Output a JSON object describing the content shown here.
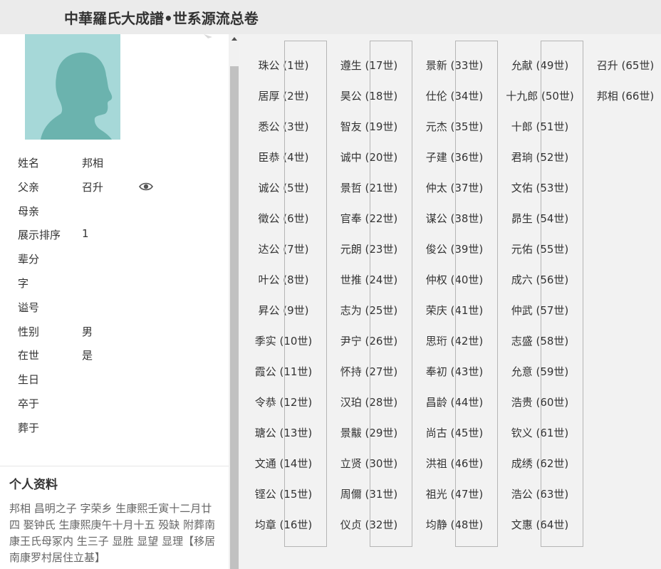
{
  "header": {
    "title": "中華羅氏大成譜•世系源流总卷"
  },
  "person": {
    "fields": [
      {
        "label": "姓名",
        "value": "邦相"
      },
      {
        "label": "父亲",
        "value": "召升"
      },
      {
        "label": "母亲",
        "value": ""
      },
      {
        "label": "展示排序",
        "value": "1"
      },
      {
        "label": "辈分",
        "value": ""
      },
      {
        "label": "字",
        "value": ""
      },
      {
        "label": "谥号",
        "value": ""
      },
      {
        "label": "性别",
        "value": "男"
      },
      {
        "label": "在世",
        "value": "是"
      },
      {
        "label": "生日",
        "value": ""
      },
      {
        "label": "卒于",
        "value": ""
      },
      {
        "label": "葬于",
        "value": ""
      }
    ],
    "icons": {
      "avatar": "person-silhouette-icon",
      "father_view": "eye-icon",
      "edit": "pencil-icon"
    }
  },
  "profile": {
    "title": "个人资料",
    "text": "邦相 昌明之子 字荣乡 生康熙壬寅十二月廿四 娶钟氏 生康熙庚午十月十五 殁缺 附葬南康王氏母冢内 生三子 显胜 显望 显理【移居南康罗村居住立基】"
  },
  "lineage": {
    "columns": [
      [
        "珠公 (1世)",
        "居厚 (2世)",
        "悉公 (3世)",
        "臣恭 (4世)",
        "诚公 (5世)",
        "徵公 (6世)",
        "达公 (7世)",
        "叶公 (8世)",
        "昇公 (9世)",
        "季实 (10世)",
        "霞公 (11世)",
        "令恭 (12世)",
        "瑭公 (13世)",
        "文通 (14世)",
        "铿公 (15世)",
        "均章 (16世)"
      ],
      [
        "遵生 (17世)",
        "昊公 (18世)",
        "智友 (19世)",
        "诚中 (20世)",
        "景哲 (21世)",
        "官奉 (22世)",
        "元朗 (23世)",
        "世推 (24世)",
        "志为 (25世)",
        "尹宁 (26世)",
        "怀持 (27世)",
        "汉珀 (28世)",
        "景黻 (29世)",
        "立贤 (30世)",
        "周儞 (31世)",
        "仪贞 (32世)"
      ],
      [
        "景新 (33世)",
        "仕伦 (34世)",
        "元杰 (35世)",
        "子建 (36世)",
        "仲太 (37世)",
        "谋公 (38世)",
        "俊公 (39世)",
        "仲权 (40世)",
        "荣庆 (41世)",
        "思珩 (42世)",
        "奉初 (43世)",
        "昌龄 (44世)",
        "尚古 (45世)",
        "洪祖 (46世)",
        "祖光 (47世)",
        "均静 (48世)"
      ],
      [
        "允献 (49世)",
        "十九郎 (50世)",
        "十郎 (51世)",
        "君珦 (52世)",
        "文佑 (53世)",
        "昴生 (54世)",
        "元佑 (55世)",
        "成六 (56世)",
        "仲武 (57世)",
        "志盛 (58世)",
        "允意 (59世)",
        "浩贵 (60世)",
        "钦义 (61世)",
        "成绣 (62世)",
        "浩公 (63世)",
        "文惠 (64世)"
      ],
      [
        "召升 (65世)",
        "邦相 (66世)"
      ]
    ]
  },
  "colors": {
    "header_bg": "#ebebeb",
    "avatar_bg": "#a6d8d8",
    "avatar_silhouette": "#6bb3ae",
    "tree_bg": "#f2f2f2",
    "connector": "#b5b5b5"
  }
}
